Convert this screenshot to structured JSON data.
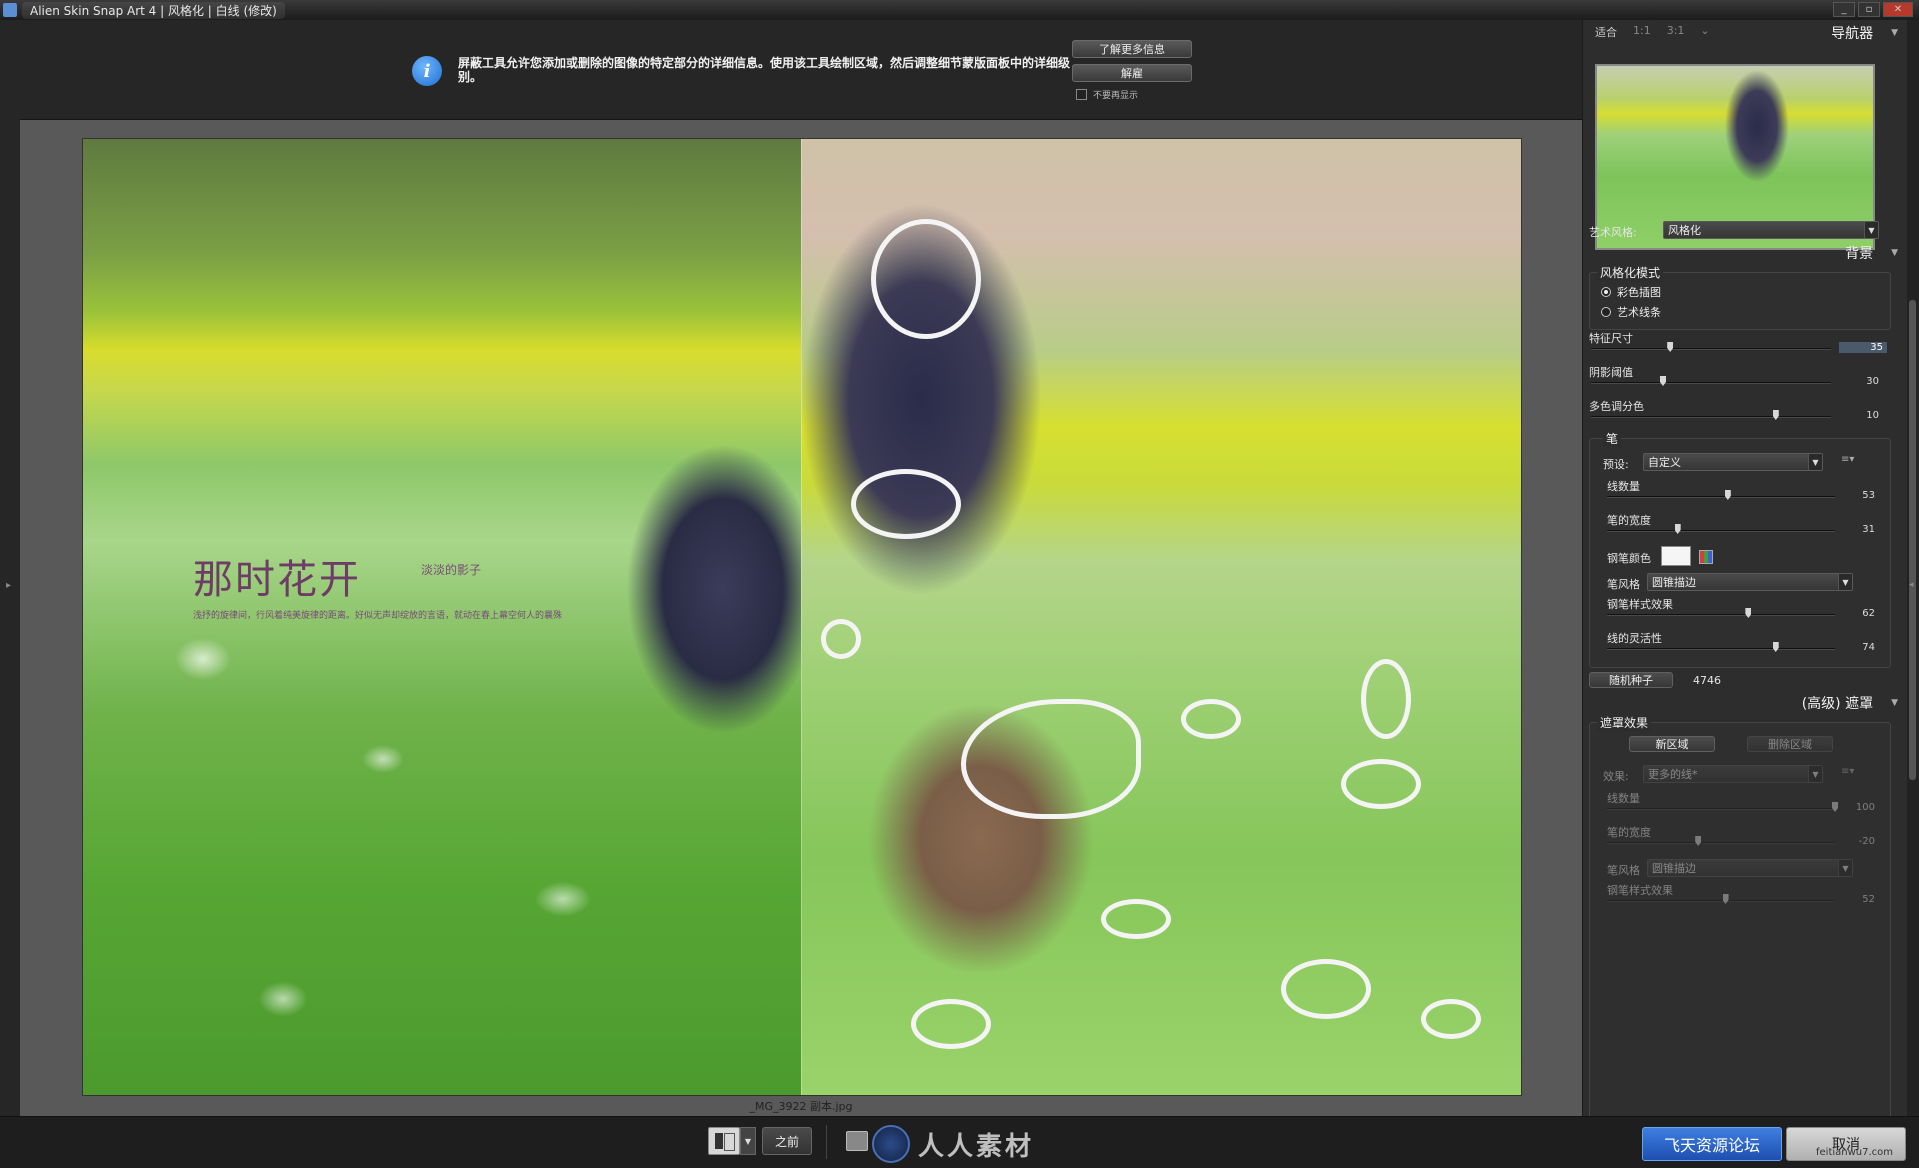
{
  "window": {
    "title": "Alien Skin Snap Art 4 | 风格化 | 白线 (修改)",
    "controls": [
      "minimize",
      "maximize",
      "close"
    ]
  },
  "info_bar": {
    "icon": "info-icon",
    "message": "屏蔽工具允许您添加或删除的图像的特定部分的详细信息。使用该工具绘制区域，然后调整细节蒙版面板中的详细级别。",
    "learn_more_label": "了解更多信息",
    "dismiss_label": "解雇",
    "dont_show_label": "不要再显示",
    "dont_show_checked": false
  },
  "canvas": {
    "filename": "_MG_3922 副本.jpg",
    "photo_watermark": {
      "title": "那时花开",
      "subtitle": "淡淡的影子",
      "tagline": "浅抒的旋律间，行风着纯美旋律的距离。好似无声却绽放的言语，就动在春上幕空何人的曩殊"
    }
  },
  "navigator": {
    "title": "导航器",
    "zoom_options": [
      "适合",
      "1:1",
      "3:1"
    ]
  },
  "art_style": {
    "label": "艺术风格:",
    "value": "风格化"
  },
  "background_section": {
    "title": "背景",
    "mode_group": {
      "title": "风格化模式",
      "options": [
        {
          "label": "彩色插图",
          "selected": true
        },
        {
          "label": "艺术线条",
          "selected": false
        }
      ]
    },
    "sliders": [
      {
        "label": "特征尺寸",
        "value": "35",
        "fraction": 0.33
      },
      {
        "label": "阴影阈值",
        "value": "30",
        "fraction": 0.3
      },
      {
        "label": "多色调分色",
        "value": "10",
        "fraction": 0.77
      }
    ],
    "pen_group": {
      "title": "笔",
      "preset_label": "预设:",
      "preset_value": "自定义",
      "sliders": [
        {
          "label": "线数量",
          "value": "53",
          "fraction": 0.53
        },
        {
          "label": "笔的宽度",
          "value": "31",
          "fraction": 0.31
        }
      ],
      "pen_color_label": "钢笔颜色",
      "pen_color": "#f5f5f5",
      "pen_style_label": "笔风格",
      "pen_style_value": "圆锥描边",
      "sliders2": [
        {
          "label": "钢笔样式效果",
          "value": "62",
          "fraction": 0.62
        },
        {
          "label": "线的灵活性",
          "value": "74",
          "fraction": 0.74
        }
      ]
    },
    "random_seed_label": "随机种子",
    "random_seed_value": "4746"
  },
  "mask_section": {
    "title": "(高级) 遮罩",
    "group": {
      "title": "遮罩效果",
      "new_area_label": "新区域",
      "delete_area_label": "删除区域",
      "effect_label": "效果:",
      "effect_value": "更多的线*",
      "sliders": [
        {
          "label": "线数量",
          "value": "100",
          "fraction": 1.0
        },
        {
          "label": "笔的宽度",
          "value": "-20",
          "fraction": 0.4
        }
      ],
      "pen_style_label": "笔风格",
      "pen_style_value": "圆锥描边",
      "last_slider": {
        "label": "钢笔样式效果",
        "value": "52",
        "fraction": 0.52
      }
    }
  },
  "bottom_bar": {
    "before_label": "之前",
    "watermark_text": "人人素材",
    "apply_label": "飞天资源论坛",
    "cancel_label": "取消",
    "site_watermark": "feitianwu7.com"
  },
  "colors": {
    "accent": "#2f6fd6",
    "panel_bg": "#2d2d2d",
    "canvas_bg": "#595959"
  }
}
